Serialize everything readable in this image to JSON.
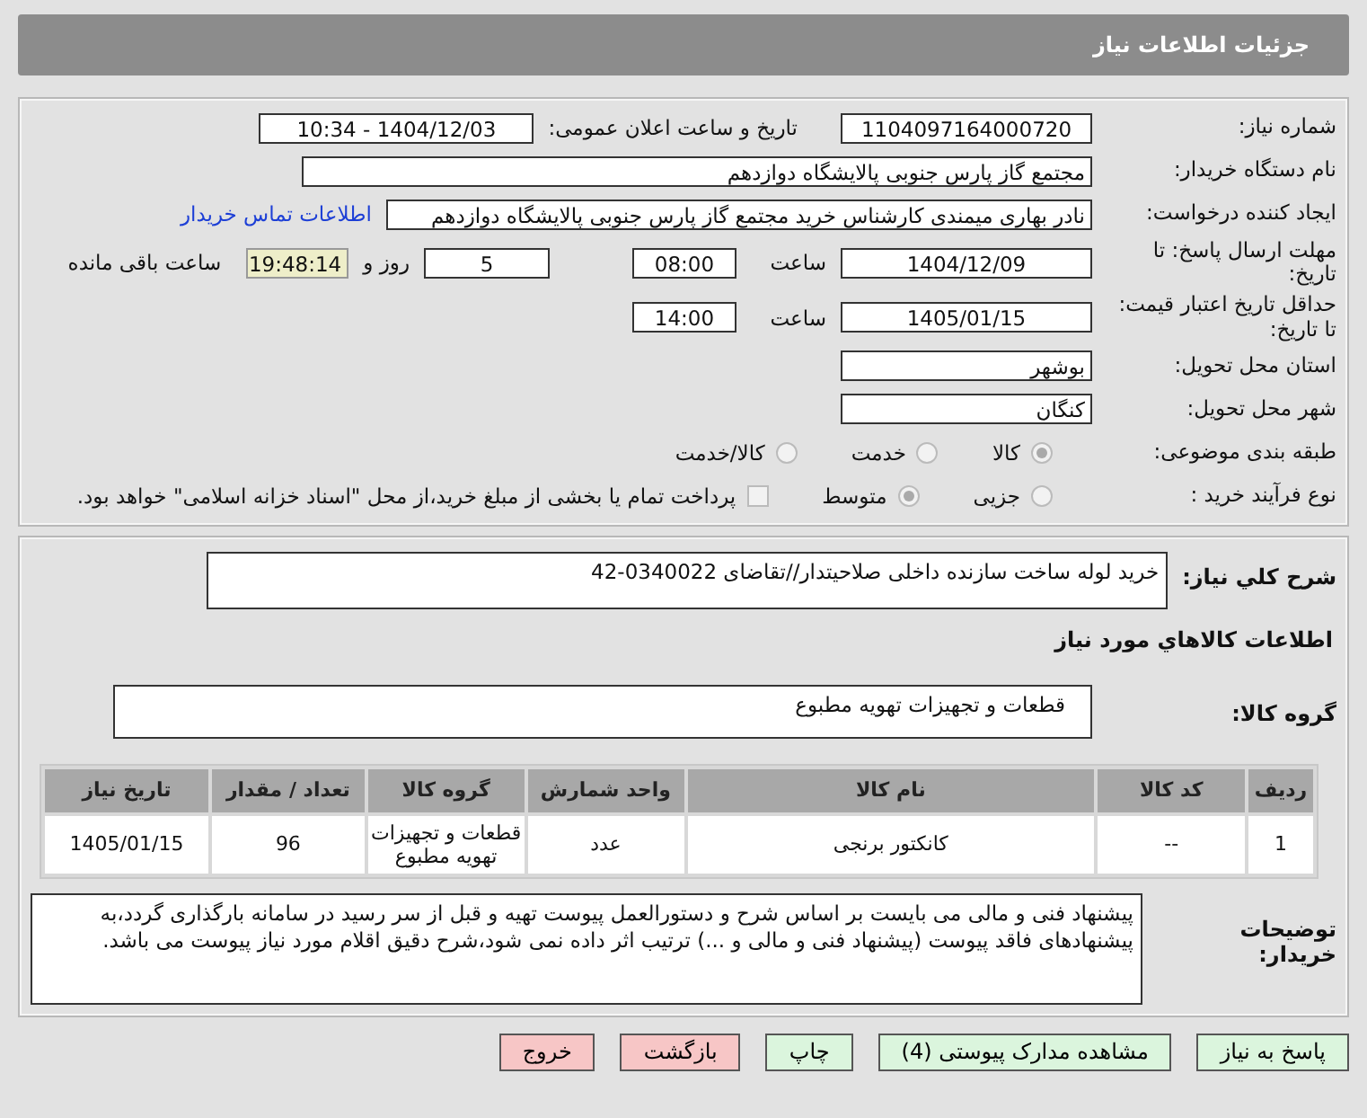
{
  "header": {
    "title": "جزئیات اطلاعات نیاز"
  },
  "need_number": {
    "label": "شماره نیاز:",
    "value": "1104097164000720"
  },
  "announce": {
    "label": "تاریخ و ساعت اعلان عمومی:",
    "value": "1404/12/03 - 10:34"
  },
  "buyer_org": {
    "label": "نام دستگاه خریدار:",
    "value": "مجتمع گاز پارس جنوبی  پالایشگاه دوازدهم"
  },
  "requester": {
    "label": "ایجاد کننده درخواست:",
    "value": "نادر بهاری میمندی کارشناس خرید مجتمع گاز پارس جنوبی  پالایشگاه دوازدهم",
    "link": "اطلاعات تماس خریدار"
  },
  "response_deadline": {
    "label": "مهلت ارسال پاسخ: تا تاریخ:",
    "date": "1404/12/09",
    "time_label": "ساعت",
    "time": "08:00",
    "days": "5",
    "days_label": "روز و",
    "remaining": "19:48:14",
    "remaining_label": "ساعت باقی مانده"
  },
  "price_validity": {
    "label": "حداقل تاریخ اعتبار قیمت: تا تاریخ:",
    "date": "1405/01/15",
    "time_label": "ساعت",
    "time": "14:00"
  },
  "province": {
    "label": "استان محل تحویل:",
    "value": "بوشهر"
  },
  "city": {
    "label": "شهر محل تحویل:",
    "value": "کنگان"
  },
  "category": {
    "label": "طبقه بندی موضوعی:",
    "options": [
      {
        "label": "کالا",
        "selected": true
      },
      {
        "label": "خدمت",
        "selected": false
      },
      {
        "label": "کالا/خدمت",
        "selected": false
      }
    ]
  },
  "process": {
    "label": "نوع فرآیند خرید :",
    "options": [
      {
        "label": "جزیی",
        "selected": false
      },
      {
        "label": "متوسط",
        "selected": true
      }
    ],
    "checkbox": {
      "label": "پرداخت تمام یا بخشی از مبلغ خرید،از محل \"اسناد خزانه اسلامی\" خواهد بود.",
      "checked": false
    }
  },
  "description": {
    "label": "شرح کلي نياز:",
    "value": "خرید لوله ساخت سازنده داخلی صلاحیتدار//تقاضای 0340022-42"
  },
  "goods_title": "اطلاعات کالاهاي مورد نياز",
  "goods_group": {
    "label": "گروه کالا:",
    "value": "قطعات و تجهیزات تهویه مطبوع"
  },
  "table": {
    "columns": [
      "ردیف",
      "کد کالا",
      "نام کالا",
      "واحد شمارش",
      "گروه کالا",
      "تعداد / مقدار",
      "تاریخ نیاز"
    ],
    "rows": [
      [
        "1",
        "--",
        "کانکتور برنجی",
        "عدد",
        "قطعات و تجهیزات تهویه مطبوع",
        "96",
        "1405/01/15"
      ]
    ]
  },
  "buyer_notes": {
    "label": "توضیحات خریدار:",
    "value": "پیشنهاد فنی و مالی می بایست بر اساس شرح و دستورالعمل پیوست تهیه و قبل از سر رسید در سامانه بارگذاری گردد،به پیشنهادهای فاقد پیوست (پیشنهاد فنی و مالی و ...) ترتیب اثر داده نمی شود،شرح دقیق اقلام مورد نیاز پیوست می باشد."
  },
  "buttons": [
    {
      "label": "پاسخ به نیاز",
      "kind": "primary"
    },
    {
      "label": "مشاهده مدارک پیوستی (4)",
      "kind": "primary"
    },
    {
      "label": "چاپ",
      "kind": "primary"
    },
    {
      "label": "بازگشت",
      "kind": "danger"
    },
    {
      "label": "خروج",
      "kind": "danger"
    }
  ]
}
